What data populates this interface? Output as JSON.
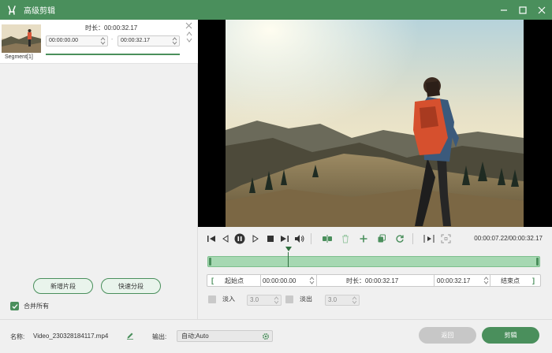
{
  "window": {
    "title": "高级剪辑",
    "icon": "rabbit-logo-icon",
    "controls": [
      "minimize-icon",
      "maximize-icon",
      "close-icon"
    ]
  },
  "segment": {
    "label": "Segment[1]",
    "duration_label": "时长：00:00:32.17",
    "start_time": "00:00:00.00",
    "range_separator": "-",
    "end_time": "00:00:32.17"
  },
  "left_actions": {
    "new_segment": "新增片段",
    "fast_split": "快速分段",
    "merge_all": "合并所有",
    "merge_all_checked": true
  },
  "playback": {
    "current_time": "00:00:07.22/00:00:32.17",
    "position_fraction": 0.24
  },
  "trim": {
    "start_point_label": "起始点",
    "start_time": "00:00:00.00",
    "duration_label": "时长：00:00:32.17",
    "end_time": "00:00:32.17",
    "end_point_label": "结束点"
  },
  "fade": {
    "fade_in_label": "淡入",
    "fade_in_value": "3.0",
    "fade_in_checked": false,
    "fade_out_label": "淡出",
    "fade_out_value": "3.0",
    "fade_out_checked": false
  },
  "bottom": {
    "name_label": "名称:",
    "file_name": "Video_230328184117.mp4",
    "output_label": "输出:",
    "output_value": "自动;Auto",
    "back_button": "返回",
    "cut_button": "剪辑"
  },
  "colors": {
    "accent": "#4a8f5c",
    "timeline_fill": "#a6d8b2"
  }
}
